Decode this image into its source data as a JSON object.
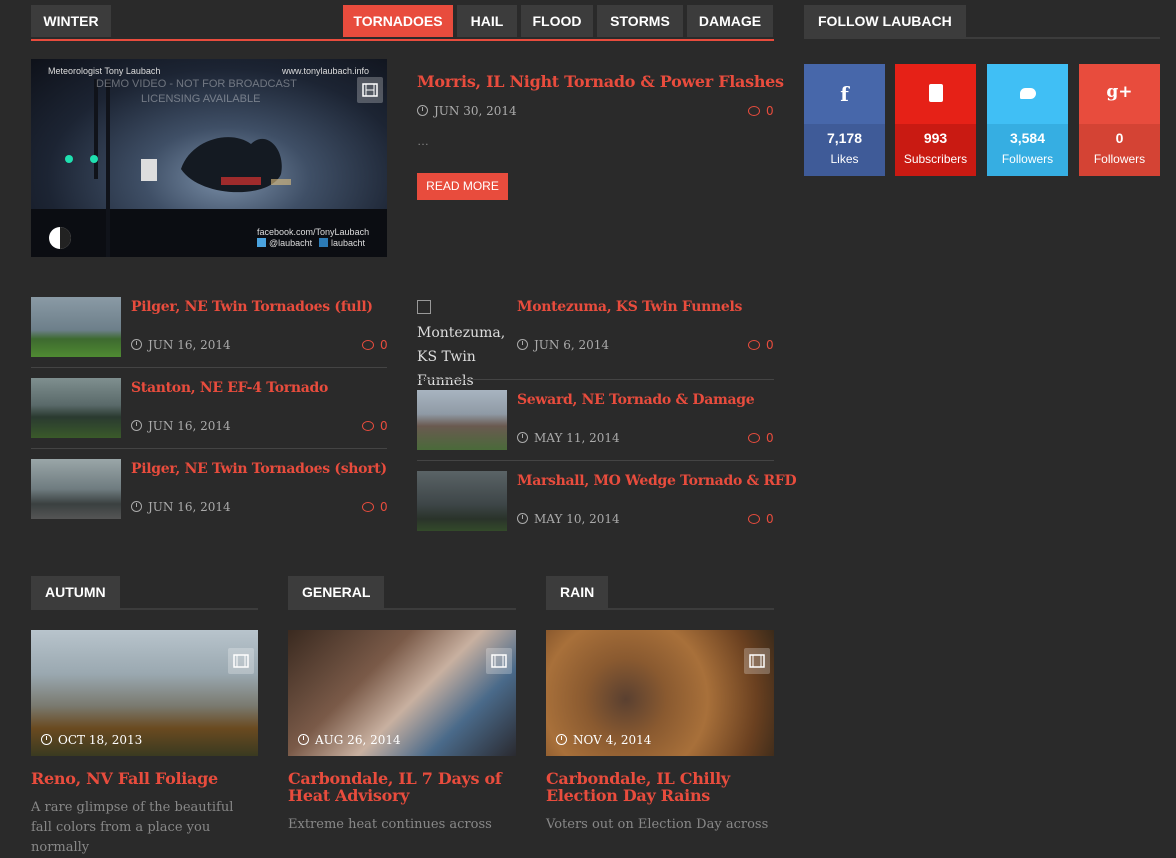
{
  "tabs": {
    "winter": "WINTER",
    "tornadoes": "TORNADOES",
    "hail": "HAIL",
    "flood": "FLOOD",
    "storms": "STORMS",
    "damage": "DAMAGE"
  },
  "featured": {
    "title": "Morris, IL Night Tornado & Power Flashes",
    "date": "JUN 30, 2014",
    "comments": "0",
    "excerpt": "…",
    "read_more": "READ MORE",
    "watermark_top_left": "Meteorologist Tony Laubach",
    "watermark_top_right": "www.tonylaubach.info",
    "watermark_center_1": "DEMO VIDEO - NOT FOR BROADCAST",
    "watermark_center_2": "LICENSING AVAILABLE",
    "social_1": "facebook.com/TonyLaubach",
    "social_2": "@laubacht",
    "social_3": "laubacht"
  },
  "left_list": [
    {
      "title": "Pilger, NE Twin Tornadoes (full)",
      "date": "JUN 16, 2014",
      "comments": "0"
    },
    {
      "title": "Stanton, NE EF-4 Tornado",
      "date": "JUN 16, 2014",
      "comments": "0"
    },
    {
      "title": "Pilger, NE Twin Tornadoes (short)",
      "date": "JUN 16, 2014",
      "comments": "0"
    }
  ],
  "right_list": [
    {
      "title": "Montezuma, KS Twin Funnels",
      "date": "JUN 6, 2014",
      "comments": "0",
      "alt": "Montezuma, KS Twin Funnels"
    },
    {
      "title": "Seward, NE Tornado & Damage",
      "date": "MAY 11, 2014",
      "comments": "0"
    },
    {
      "title": "Marshall, MO Wedge Tornado & RFD",
      "date": "MAY 10, 2014",
      "comments": "0"
    }
  ],
  "follow": {
    "title": "FOLLOW LAUBACH",
    "facebook": {
      "count": "7,178",
      "label": "Likes",
      "color": "#4767aa"
    },
    "youtube": {
      "count": "993",
      "label": "Subscribers",
      "color": "#e62117"
    },
    "twitter": {
      "count": "3,584",
      "label": "Followers",
      "color": "#40bff5"
    },
    "gplus": {
      "count": "0",
      "label": "Followers",
      "color": "#e84c3d"
    }
  },
  "categories": [
    {
      "section": "AUTUMN",
      "date": "OCT 18, 2013",
      "title": "Reno, NV Fall Foliage",
      "excerpt": "A rare glimpse of the beautiful fall colors from a place you normally"
    },
    {
      "section": "GENERAL",
      "date": "AUG 26, 2014",
      "title": "Carbondale, IL 7 Days of Heat Advisory",
      "excerpt": "Extreme heat continues across"
    },
    {
      "section": "RAIN",
      "date": "NOV 4, 2014",
      "title": "Carbondale, IL Chilly Election Day Rains",
      "excerpt": "Voters out on Election Day across"
    }
  ]
}
